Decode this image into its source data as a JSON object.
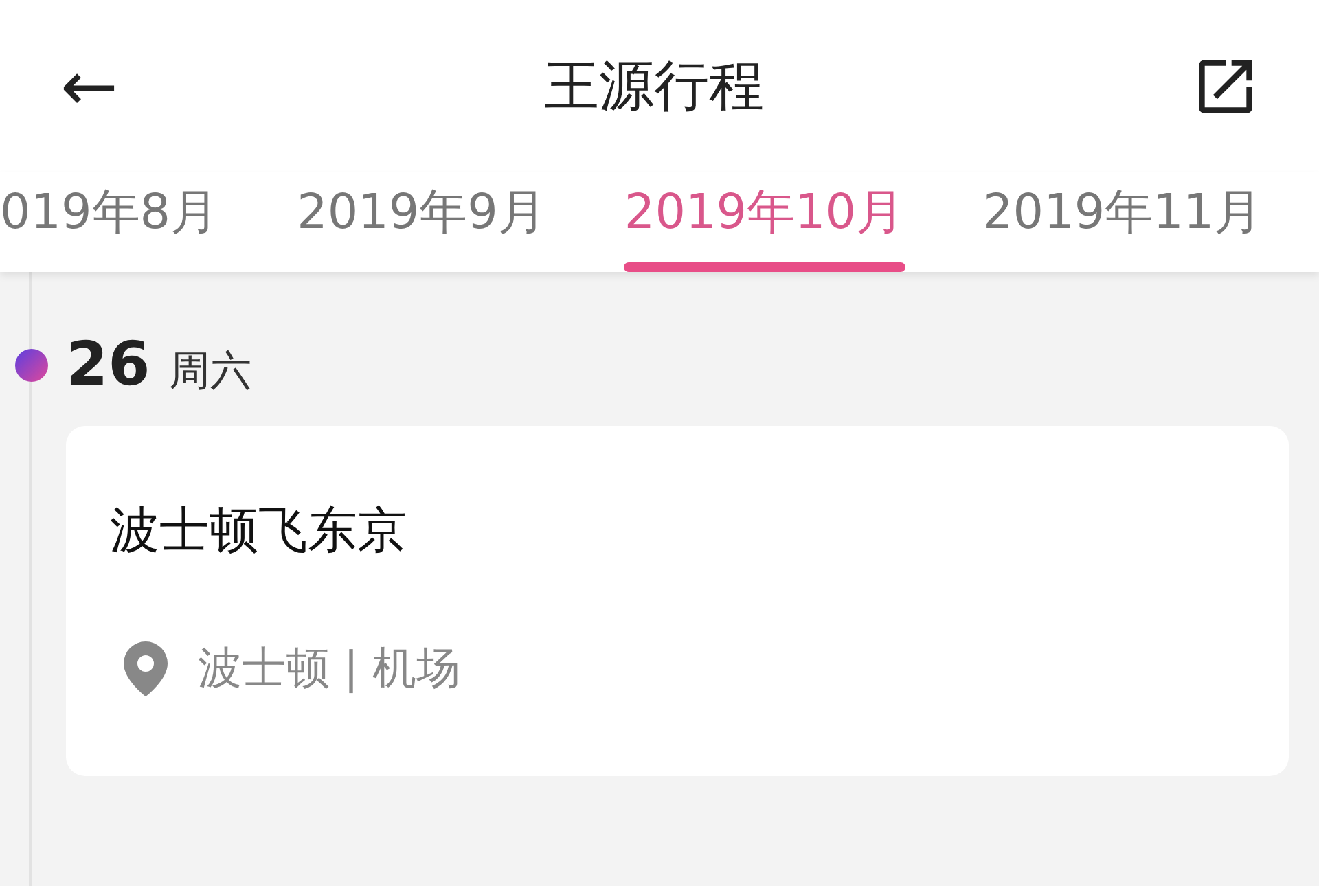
{
  "header": {
    "back": "←",
    "title": "王源行程"
  },
  "tabs": [
    {
      "label": "019年8月",
      "selected": false
    },
    {
      "label": "2019年9月",
      "selected": false
    },
    {
      "label": "2019年10月",
      "selected": true
    },
    {
      "label": "2019年11月",
      "selected": false
    }
  ],
  "days": [
    {
      "day": "26",
      "weekday": "周六",
      "events": [
        {
          "title": "波士顿飞东京",
          "location": "波士顿 | 机场"
        }
      ]
    }
  ]
}
